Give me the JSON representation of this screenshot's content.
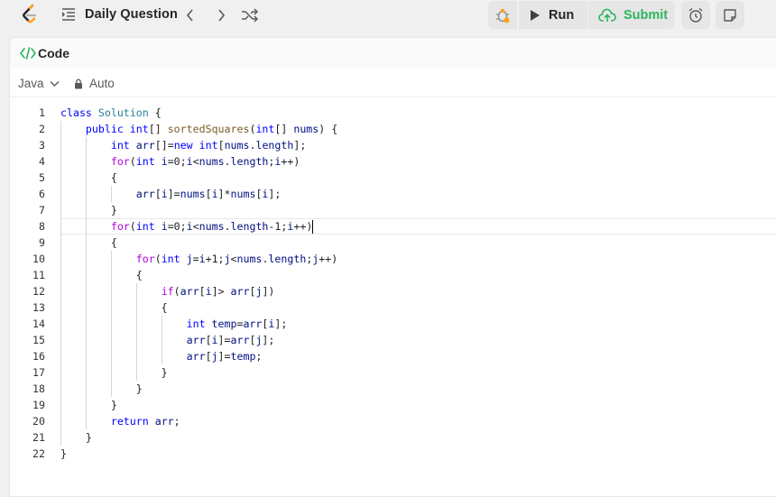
{
  "topbar": {
    "title": "Daily Question",
    "run_label": "Run",
    "submit_label": "Submit"
  },
  "panel": {
    "tab_label": "Code",
    "language": "Java",
    "autosave": "Auto"
  },
  "editor": {
    "current_line": 8,
    "lines": [
      {
        "n": "1",
        "code": "class Solution {"
      },
      {
        "n": "2",
        "code": "    public int[] sortedSquares(int[] nums) {"
      },
      {
        "n": "3",
        "code": "        int arr[]=new int[nums.length];"
      },
      {
        "n": "4",
        "code": "        for(int i=0;i<nums.length;i++)"
      },
      {
        "n": "5",
        "code": "        {"
      },
      {
        "n": "6",
        "code": "            arr[i]=nums[i]*nums[i];"
      },
      {
        "n": "7",
        "code": "        }"
      },
      {
        "n": "8",
        "code": "        for(int i=0;i<nums.length-1;i++)"
      },
      {
        "n": "9",
        "code": "        {"
      },
      {
        "n": "10",
        "code": "            for(int j=i+1;j<nums.length;j++)"
      },
      {
        "n": "11",
        "code": "            {"
      },
      {
        "n": "12",
        "code": "                if(arr[i]> arr[j])"
      },
      {
        "n": "13",
        "code": "                {"
      },
      {
        "n": "14",
        "code": "                    int temp=arr[i];"
      },
      {
        "n": "15",
        "code": "                    arr[i]=arr[j];"
      },
      {
        "n": "16",
        "code": "                    arr[j]=temp;"
      },
      {
        "n": "17",
        "code": "                }"
      },
      {
        "n": "18",
        "code": "            }"
      },
      {
        "n": "19",
        "code": "        }"
      },
      {
        "n": "20",
        "code": "        return arr;"
      },
      {
        "n": "21",
        "code": "    }"
      },
      {
        "n": "22",
        "code": "}"
      }
    ]
  },
  "colors": {
    "accent_green": "#2db55d",
    "logo_orange": "#ffa116",
    "keyword": "#0000ff",
    "control": "#af00db",
    "type": "#267f99",
    "function": "#795e26"
  },
  "icons": {
    "logo": "leetcode-logo-icon",
    "list": "problem-list-icon",
    "prev": "chevron-left-icon",
    "next": "chevron-right-icon",
    "shuffle": "shuffle-icon",
    "debug": "debug-bug-icon",
    "run": "play-icon",
    "submit": "cloud-upload-icon",
    "timer": "alarm-clock-icon",
    "notes": "note-icon",
    "code": "code-brackets-icon",
    "lock": "lock-icon",
    "dropdown": "chevron-down-icon"
  }
}
